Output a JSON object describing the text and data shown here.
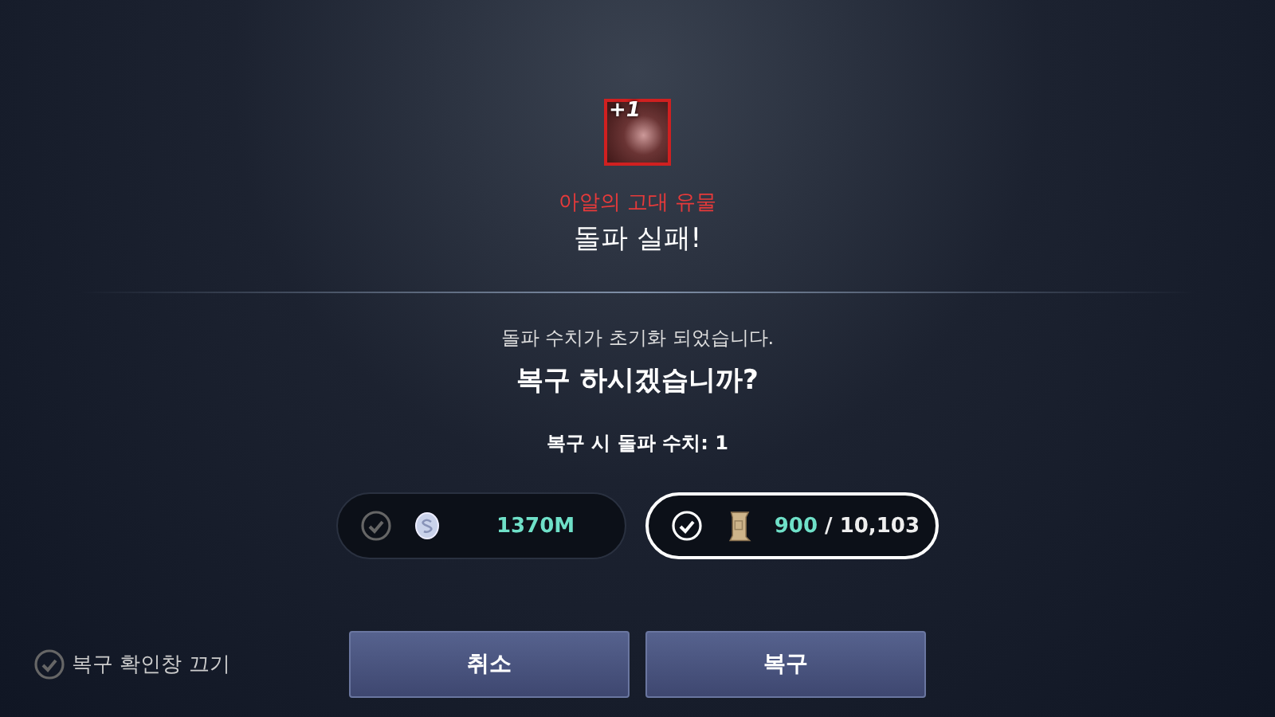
{
  "item": {
    "enhance": "+1",
    "name": "아알의 고대 유물"
  },
  "result": "돌파 실패!",
  "message": "돌파 수치가 초기화 되었습니다.",
  "question": "복구 하시겠습니까?",
  "restore_info": "복구 시 돌파 수치: 1",
  "costs": [
    {
      "kind": "silver",
      "amount": "1370M",
      "selected": false
    },
    {
      "kind": "scroll",
      "amount": "900",
      "total": "/ 10,103",
      "selected": true
    }
  ],
  "dont_show": {
    "label": "복구 확인창 끄기",
    "checked": false
  },
  "buttons": [
    "취소",
    "복구"
  ]
}
